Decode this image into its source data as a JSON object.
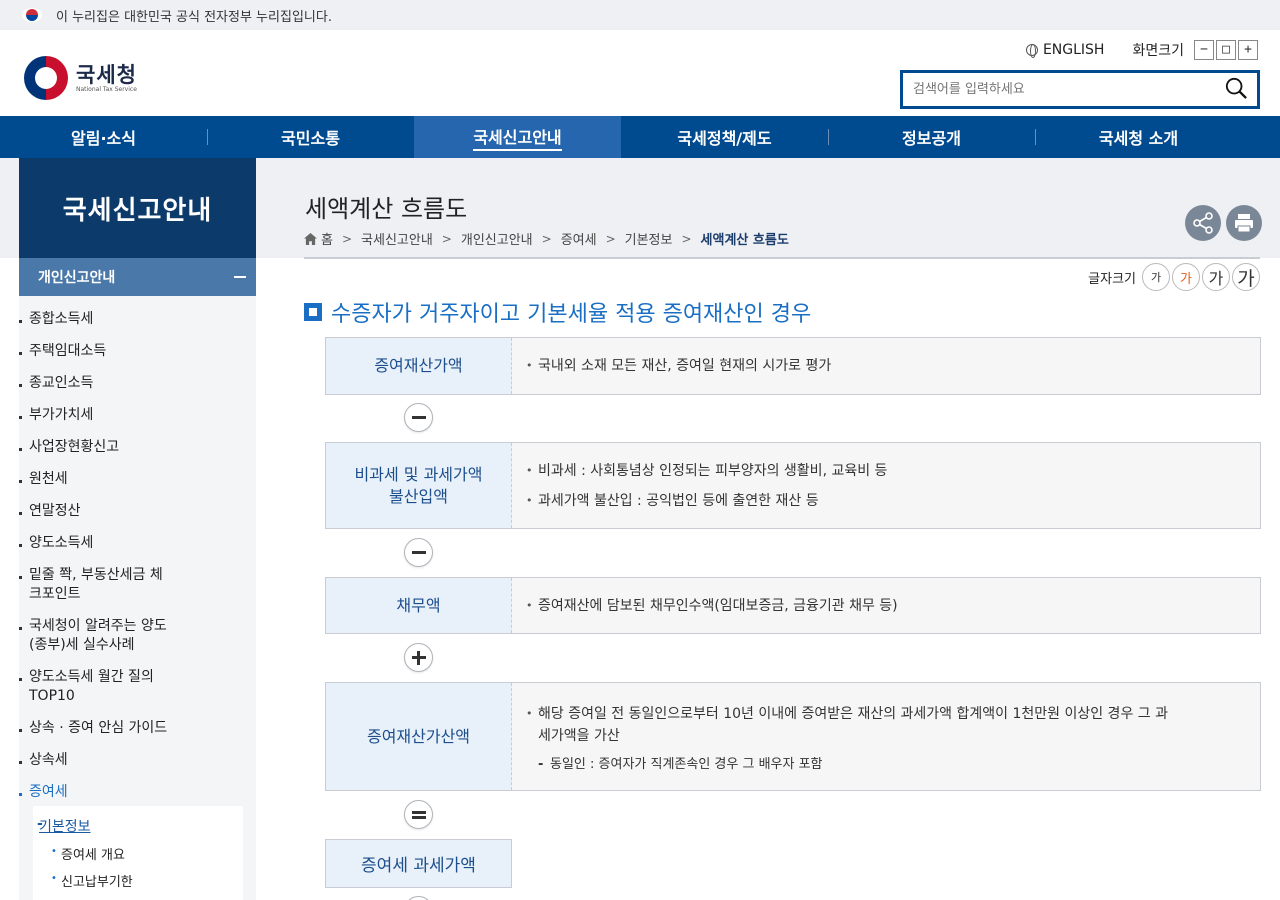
{
  "gov_banner": {
    "text": "이 누리집은 대한민국 공식 전자정부 누리집입니다."
  },
  "logo": {
    "name": "국세청",
    "subtitle": "National Tax Service"
  },
  "util": {
    "english": "ENGLISH",
    "zoom_label": "화면크기",
    "zoom_out": "−",
    "zoom_reset": "□",
    "zoom_in": "+"
  },
  "search": {
    "placeholder": "검색어를 입력하세요"
  },
  "gnb": [
    "알림·소식",
    "국민소통",
    "국세신고안내",
    "국세정책/제도",
    "정보공개",
    "국세청 소개"
  ],
  "sidebar": {
    "title": "국세신고안내",
    "section": "개인신고안내",
    "items": [
      "종합소득세",
      "주택임대소득",
      "종교인소득",
      "부가가치세",
      "사업장현황신고",
      "원천세",
      "연말정산",
      "양도소득세",
      "밑줄 쫙, 부동산세금 체크포인트",
      "국세청이 알려주는 양도(종부)세 실수사례",
      "양도소득세 월간 질의 TOP10",
      "상속 · 증여 안심 가이드",
      "상속세",
      "증여세"
    ],
    "sub_title": "기본정보",
    "sub_items": [
      "증여세 개요",
      "신고납부기한"
    ]
  },
  "page": {
    "title": "세액계산 흐름도",
    "breadcrumb": [
      "홈",
      "국세신고안내",
      "개인신고안내",
      "증여세",
      "기본정보",
      "세액계산 흐름도"
    ]
  },
  "fontsize": {
    "label": "글자크기",
    "buttons": [
      "가",
      "가",
      "가",
      "가"
    ]
  },
  "heading": "수증자가 거주자이고 기본세율 적용 증여재산인 경우",
  "flow": [
    {
      "key": "증여재산가액",
      "lines": [
        "국내외 소재 모든 재산, 증여일 현재의 시가로 평가"
      ]
    },
    {
      "key": "비과세 및 과세가액 불산입액",
      "lines": [
        "비과세 : 사회통념상 인정되는 피부양자의 생활비, 교육비 등",
        "과세가액 불산입 : 공익법인 등에 출연한 재산 등"
      ]
    },
    {
      "key": "채무액",
      "lines": [
        "증여재산에 담보된 채무인수액(임대보증금, 금융기관 채무 등)"
      ]
    },
    {
      "key": "증여재산가산액",
      "lines": [
        "해당 증여일 전 동일인으로부터 10년 이내에 증여받은 재산의 과세가액 합계액이 1천만원 이상인 경우 그 과세가액을 가산"
      ],
      "dash": "동일인 : 증여자가 직계존속인 경우 그 배우자 포함"
    },
    {
      "key": "증여세 과세가액"
    }
  ],
  "operators": [
    "minus",
    "minus",
    "plus",
    "equals"
  ],
  "colors": {
    "primary": "#004a8f",
    "active_tab": "#2566ae",
    "side_title": "#0b3a6b",
    "accent": "#1a6fc4"
  }
}
